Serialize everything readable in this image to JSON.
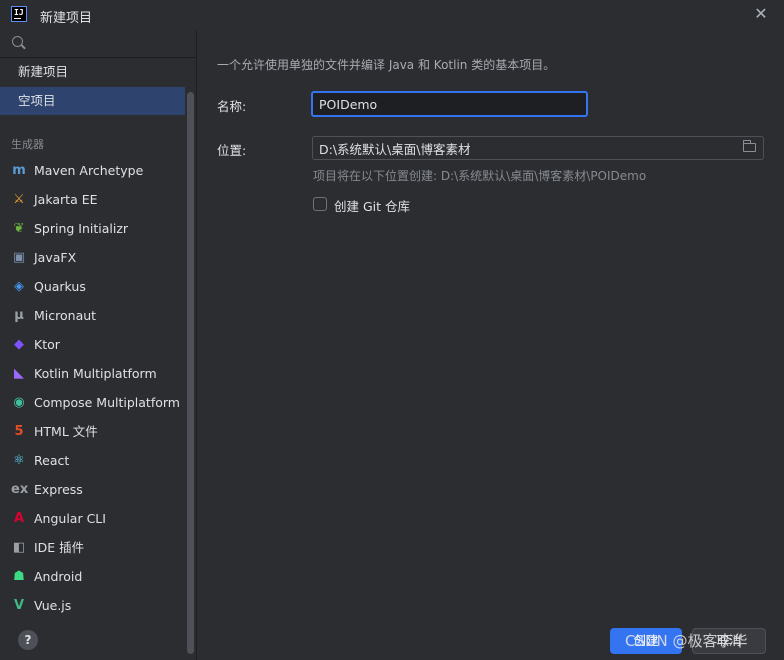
{
  "window": {
    "title": "新建项目",
    "close_icon": "close-icon"
  },
  "sidebar": {
    "search_placeholder": "",
    "project_types": [
      {
        "label": "新建项目",
        "selected": false
      },
      {
        "label": "空项目",
        "selected": true
      }
    ],
    "generators_label": "生成器",
    "generators": [
      {
        "label": "Maven Archetype",
        "icon": "maven-icon",
        "glyph": "m",
        "color": "#5b9bd5"
      },
      {
        "label": "Jakarta EE",
        "icon": "jakarta-ee-icon",
        "glyph": "⚔",
        "color": "#f0a030"
      },
      {
        "label": "Spring Initializr",
        "icon": "spring-icon",
        "glyph": "❦",
        "color": "#6db33f"
      },
      {
        "label": "JavaFX",
        "icon": "javafx-icon",
        "glyph": "▣",
        "color": "#7a8fa8"
      },
      {
        "label": "Quarkus",
        "icon": "quarkus-icon",
        "glyph": "◈",
        "color": "#4695eb"
      },
      {
        "label": "Micronaut",
        "icon": "micronaut-icon",
        "glyph": "μ",
        "color": "#9aa0a6"
      },
      {
        "label": "Ktor",
        "icon": "ktor-icon",
        "glyph": "◆",
        "color": "#7f52ff"
      },
      {
        "label": "Kotlin Multiplatform",
        "icon": "kotlin-icon",
        "glyph": "◣",
        "color": "#9b6bff"
      },
      {
        "label": "Compose Multiplatform",
        "icon": "compose-icon",
        "glyph": "◉",
        "color": "#41c0a0"
      },
      {
        "label": "HTML 文件",
        "icon": "html5-icon",
        "glyph": "5",
        "color": "#e44d26"
      },
      {
        "label": "React",
        "icon": "react-icon",
        "glyph": "⚛",
        "color": "#61dafb"
      },
      {
        "label": "Express",
        "icon": "express-icon",
        "glyph": "ex",
        "color": "#9aa0a6"
      },
      {
        "label": "Angular CLI",
        "icon": "angular-icon",
        "glyph": "A",
        "color": "#dd0031"
      },
      {
        "label": "IDE 插件",
        "icon": "plugin-icon",
        "glyph": "◧",
        "color": "#9aa0a6"
      },
      {
        "label": "Android",
        "icon": "android-icon",
        "glyph": "☗",
        "color": "#3ddc84"
      },
      {
        "label": "Vue.js",
        "icon": "vue-icon",
        "glyph": "V",
        "color": "#41b883"
      }
    ]
  },
  "main": {
    "description": "一个允许使用单独的文件并编译 Java 和 Kotlin 类的基本项目。",
    "name_label": "名称:",
    "name_value": "POIDemo",
    "location_label": "位置:",
    "location_value": "D:\\系统默认\\桌面\\博客素材",
    "location_hint": "项目将在以下位置创建: D:\\系统默认\\桌面\\博客素材\\POIDemo",
    "git_checkbox_label": "创建 Git 仓库",
    "git_checked": false
  },
  "footer": {
    "help_label": "?",
    "create_label": "创建",
    "cancel_label": "取消"
  },
  "watermark": "CSDN @极客李华",
  "colors": {
    "background": "#2b2d30",
    "accent": "#3574f0",
    "selection": "#2e436e"
  }
}
